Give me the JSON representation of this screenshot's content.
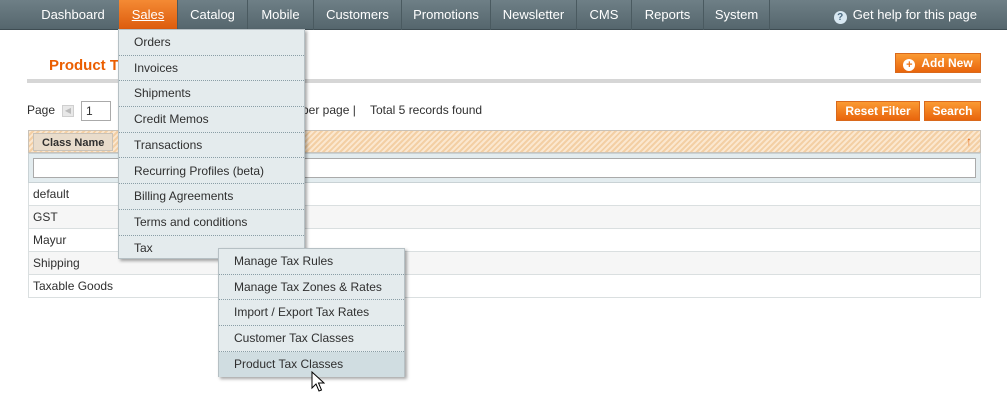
{
  "nav": {
    "items": [
      {
        "label": "Dashboard"
      },
      {
        "label": "Sales"
      },
      {
        "label": "Catalog"
      },
      {
        "label": "Mobile"
      },
      {
        "label": "Customers"
      },
      {
        "label": "Promotions"
      },
      {
        "label": "Newsletter"
      },
      {
        "label": "CMS"
      },
      {
        "label": "Reports"
      },
      {
        "label": "System"
      }
    ],
    "active": "Sales",
    "help_label": "Get help for this page",
    "help_icon": "help-icon"
  },
  "page": {
    "title": "Product Ta",
    "add_new_label": "Add New",
    "add_icon": "plus-circle-icon"
  },
  "pager": {
    "page_label": "Page",
    "page_value": "1",
    "per_page_label": "per page  |",
    "total_label": "Total 5 records found"
  },
  "actions": {
    "reset_filter_label": "Reset Filter",
    "search_label": "Search"
  },
  "grid": {
    "column_header": "Class Name",
    "sort_icon": "sort-arrow-up-icon",
    "rows": [
      "default",
      "GST",
      "Mayur",
      "Shipping",
      "Taxable Goods"
    ]
  },
  "sales_menu": {
    "items": [
      "Orders",
      "Invoices",
      "Shipments",
      "Credit Memos",
      "Transactions",
      "Recurring Profiles (beta)",
      "Billing Agreements",
      "Terms and conditions",
      "Tax"
    ]
  },
  "tax_menu": {
    "items": [
      "Manage Tax Rules",
      "Manage Tax Zones & Rates",
      "Import / Export Tax Rates",
      "Customer Tax Classes",
      "Product Tax Classes"
    ],
    "hovered": "Product Tax Classes"
  },
  "colors": {
    "nav_bg": "#5f7077",
    "accent": "#eb5e00",
    "button": "#f18b2c",
    "menu_bg": "#e4ebed"
  }
}
